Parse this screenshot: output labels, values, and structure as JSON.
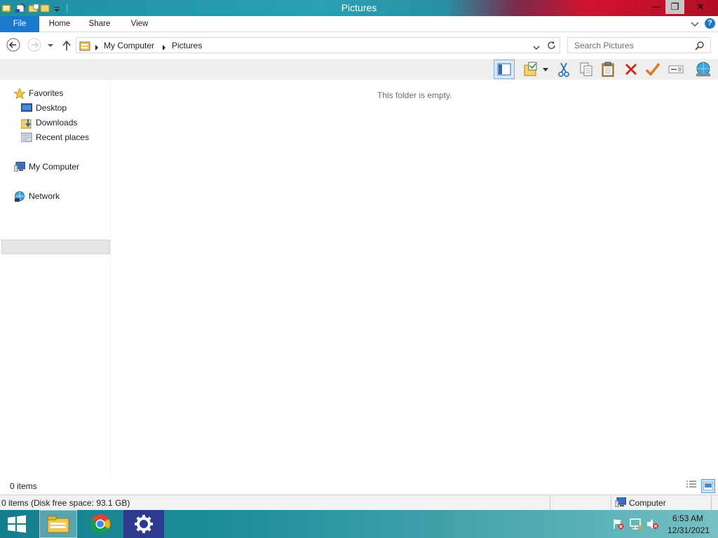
{
  "window": {
    "title": "Pictures",
    "minimize_glyph": "—",
    "restore_glyph": "❐",
    "close_glyph": "✕"
  },
  "ribbon": {
    "tabs": [
      {
        "label": "File"
      },
      {
        "label": "Home"
      },
      {
        "label": "Share"
      },
      {
        "label": "View"
      }
    ],
    "help_glyph": "?"
  },
  "address": {
    "crumbs": [
      "My Computer",
      "Pictures"
    ]
  },
  "search": {
    "placeholder": "Search Pictures"
  },
  "toolbar": {
    "icons": [
      "preview-pane-icon",
      "folder-options-icon",
      "cut-icon",
      "copy-icon",
      "paste-icon",
      "delete-icon",
      "check-icon",
      "rename-icon",
      "network-drive-icon"
    ]
  },
  "navpane": {
    "favorites": "Favorites",
    "desktop": "Desktop",
    "downloads": "Downloads",
    "recent": "Recent places",
    "computer": "My Computer",
    "network": "Network"
  },
  "content": {
    "empty_message": "This folder is empty."
  },
  "status": {
    "items": "0 items",
    "detail": "0 items (Disk free space: 93.1 GB)",
    "location": "Computer"
  },
  "taskbar": {
    "time": "6:53 AM",
    "date": "12/31/2021"
  },
  "colors": {
    "file_tab": "#1979ca",
    "taskbar": "#1b8d99",
    "titlebar_right": "#d2122e"
  }
}
